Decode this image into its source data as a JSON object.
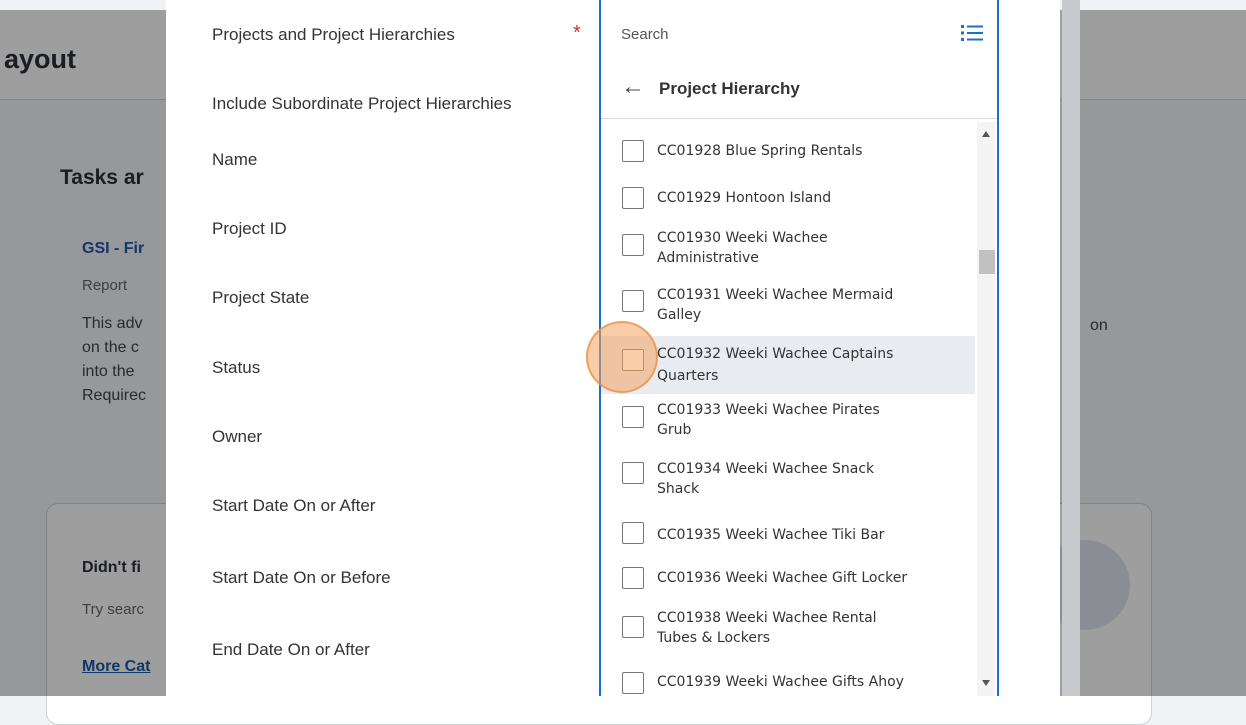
{
  "background": {
    "page_title": "ayout",
    "section_title": "Tasks ar",
    "report_link": "GSI - Fir",
    "report_type": "Report",
    "desc_lines": [
      "This adv",
      "on the c",
      "into the",
      "Requirec"
    ],
    "desc_tail": "on",
    "card_title": "Didn't fi",
    "card_text": "Try searc",
    "card_link": "More Cat"
  },
  "form": {
    "required_star": "*",
    "fields": [
      "Projects and Project Hierarchies",
      "Include Subordinate Project Hierarchies",
      "Name",
      "Project ID",
      "Project State",
      "Status",
      "Owner",
      "Start Date On or After",
      "Start Date On or Before",
      "End Date On or After"
    ]
  },
  "prompt": {
    "search_placeholder": "Search",
    "list_icon": "list-icon",
    "back_icon": "arrow-left-icon",
    "title": "Project Hierarchy",
    "items": [
      {
        "line1": "CC01928 Blue Spring Rentals",
        "line2": ""
      },
      {
        "line1": "CC01929 Hontoon Island",
        "line2": ""
      },
      {
        "line1": "CC01930 Weeki Wachee",
        "line2": "Administrative"
      },
      {
        "line1": "CC01931 Weeki Wachee Mermaid",
        "line2": "Galley"
      },
      {
        "line1": "CC01932 Weeki Wachee Captains",
        "line2": "Quarters"
      },
      {
        "line1": "CC01933 Weeki Wachee Pirates",
        "line2": "Grub"
      },
      {
        "line1": "CC01934 Weeki Wachee Snack",
        "line2": "Shack"
      },
      {
        "line1": "CC01935 Weeki Wachee Tiki Bar",
        "line2": ""
      },
      {
        "line1": "CC01936 Weeki Wachee Gift Locker",
        "line2": ""
      },
      {
        "line1": "CC01938 Weeki Wachee Rental",
        "line2": "Tubes & Lockers"
      },
      {
        "line1": "CC01939 Weeki Wachee Gifts Ahoy",
        "line2": ""
      }
    ],
    "highlighted_index": 4
  },
  "colors": {
    "accent_blue": "#1f6fc5",
    "required_red": "#d32f2f",
    "link_blue": "#1a5aa6"
  }
}
